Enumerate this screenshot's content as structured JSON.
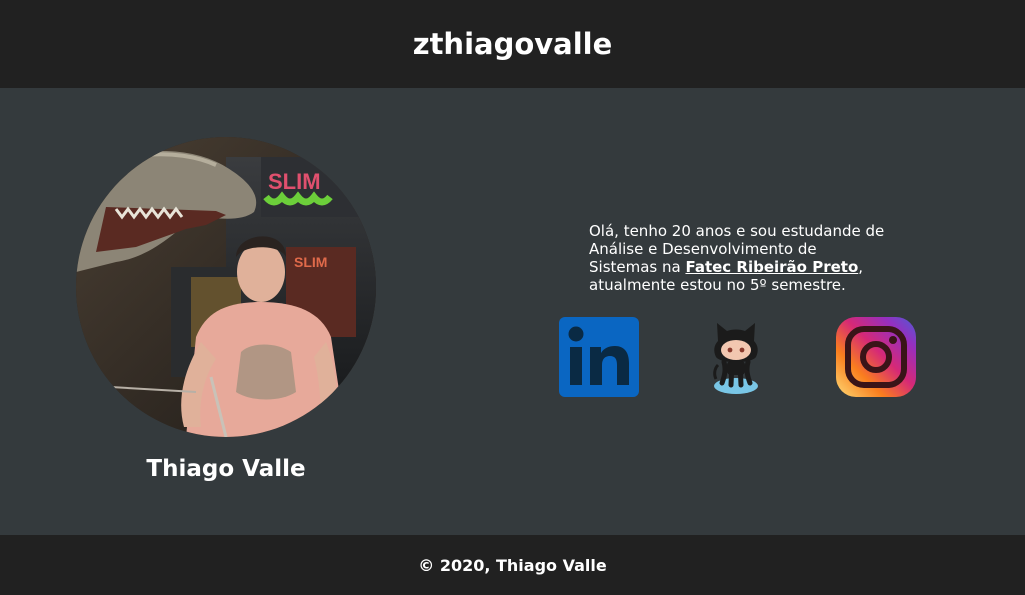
{
  "header": {
    "title": "zthiagovalle"
  },
  "profile": {
    "name": "Thiago Valle",
    "photo_icon": "profile-photo"
  },
  "bio": {
    "text_before_link": "Olá, tenho 20 anos e sou estudande de Análise e Desenvolvimento de Sistemas na ",
    "link_text": "Fatec Ribeirão Preto",
    "text_after_link": ", atualmente estou no 5º semestre."
  },
  "social": {
    "linkedin_icon": "linkedin-icon",
    "github_icon": "github-octocat-icon",
    "instagram_icon": "instagram-icon"
  },
  "footer": {
    "copyright": "© 2020, Thiago Valle"
  },
  "colors": {
    "header_bg": "#212121",
    "main_bg": "#343a3d",
    "text": "#ffffff",
    "linkedin_blue": "#0a66c2"
  }
}
